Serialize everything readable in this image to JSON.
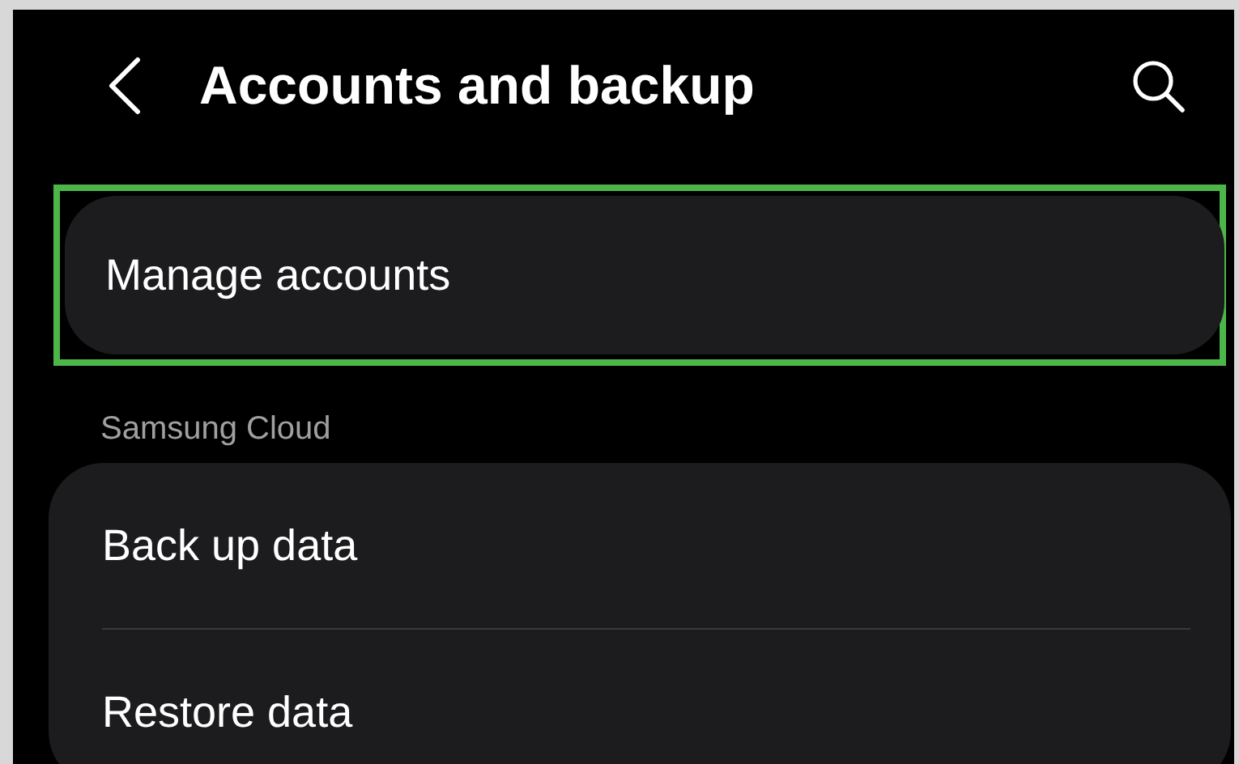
{
  "header": {
    "title": "Accounts and backup"
  },
  "top_item": {
    "label": "Manage accounts",
    "highlighted": true
  },
  "section": {
    "title": "Samsung Cloud",
    "items": [
      {
        "label": "Back up data"
      },
      {
        "label": "Restore data"
      }
    ]
  }
}
